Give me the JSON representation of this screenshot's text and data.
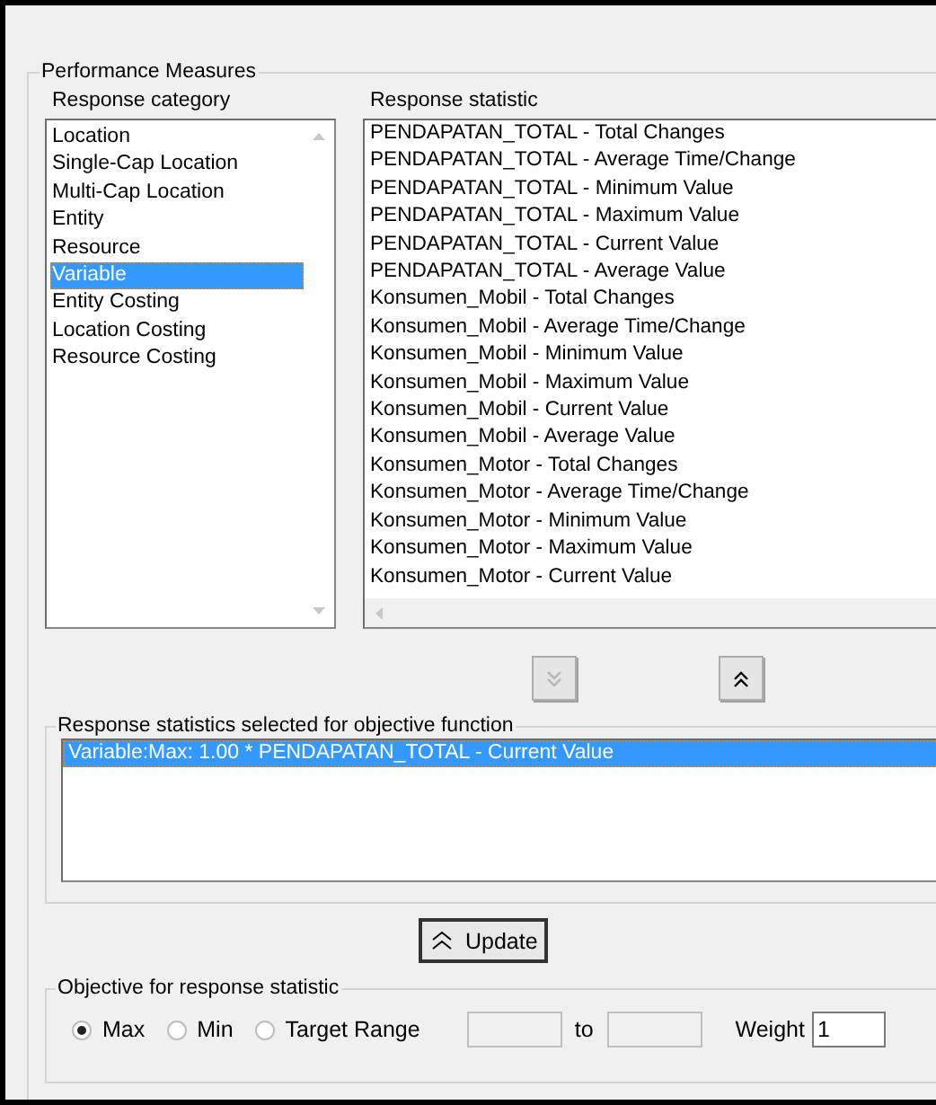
{
  "group_title": "Performance Measures",
  "category": {
    "label": "Response category",
    "items": [
      {
        "label": "Location",
        "selected": false
      },
      {
        "label": "Single-Cap Location",
        "selected": false
      },
      {
        "label": "Multi-Cap Location",
        "selected": false
      },
      {
        "label": "Entity",
        "selected": false
      },
      {
        "label": "Resource",
        "selected": false
      },
      {
        "label": "Variable",
        "selected": true
      },
      {
        "label": "Entity Costing",
        "selected": false
      },
      {
        "label": "Location Costing",
        "selected": false
      },
      {
        "label": "Resource Costing",
        "selected": false
      }
    ]
  },
  "statistic": {
    "label": "Response statistic",
    "items": [
      {
        "label": "PENDAPATAN_TOTAL - Total Changes",
        "selected": false
      },
      {
        "label": "PENDAPATAN_TOTAL - Average Time/Change",
        "selected": false
      },
      {
        "label": "PENDAPATAN_TOTAL - Minimum Value",
        "selected": false
      },
      {
        "label": "PENDAPATAN_TOTAL - Maximum Value",
        "selected": false
      },
      {
        "label": "PENDAPATAN_TOTAL - Current Value",
        "selected": false
      },
      {
        "label": "PENDAPATAN_TOTAL - Average Value",
        "selected": false
      },
      {
        "label": "Konsumen_Mobil - Total Changes",
        "selected": false
      },
      {
        "label": "Konsumen_Mobil - Average Time/Change",
        "selected": false
      },
      {
        "label": "Konsumen_Mobil - Minimum Value",
        "selected": false
      },
      {
        "label": "Konsumen_Mobil - Maximum Value",
        "selected": false
      },
      {
        "label": "Konsumen_Mobil - Current Value",
        "selected": false
      },
      {
        "label": "Konsumen_Mobil - Average Value",
        "selected": false
      },
      {
        "label": "Konsumen_Motor - Total Changes",
        "selected": false
      },
      {
        "label": "Konsumen_Motor - Average Time/Change",
        "selected": false
      },
      {
        "label": "Konsumen_Motor - Minimum Value",
        "selected": false
      },
      {
        "label": "Konsumen_Motor - Maximum Value",
        "selected": false
      },
      {
        "label": "Konsumen_Motor - Current Value",
        "selected": false
      }
    ]
  },
  "move_down": {
    "disabled": true
  },
  "move_up": {
    "disabled": false
  },
  "selected_group": {
    "title": "Response statistics selected for objective function",
    "items": [
      {
        "label": "Variable:Max: 1.00 * PENDAPATAN_TOTAL - Current Value",
        "selected": true
      }
    ]
  },
  "update_button": "Update",
  "objective": {
    "title": "Objective for response statistic",
    "options": [
      {
        "label": "Max",
        "selected": true
      },
      {
        "label": "Min",
        "selected": false
      },
      {
        "label": "Target Range",
        "selected": false
      }
    ],
    "range_disabled": true,
    "to_label": "to",
    "weight_label": "Weight",
    "weight_value": "1"
  }
}
